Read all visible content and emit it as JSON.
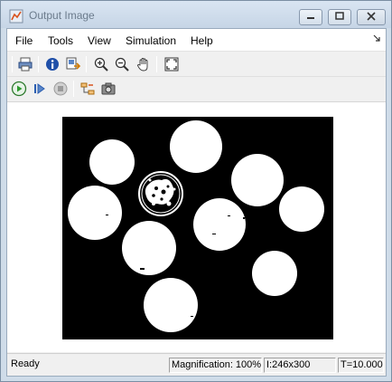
{
  "window": {
    "title": "Output Image",
    "controls": {
      "minimize_icon": "minimize-icon",
      "maximize_icon": "maximize-icon",
      "close_icon": "close-icon"
    }
  },
  "menubar": {
    "items": [
      "File",
      "Tools",
      "View",
      "Simulation",
      "Help"
    ]
  },
  "toolbar1": {
    "icons": [
      "print-icon",
      "info-icon",
      "export-image-icon",
      "zoom-in-icon",
      "zoom-out-icon",
      "pan-hand-icon",
      "fit-to-window-icon"
    ]
  },
  "toolbar2": {
    "icons": [
      "run-icon",
      "step-forward-icon",
      "stop-icon",
      "signal-hierarchy-icon",
      "snapshot-camera-icon"
    ]
  },
  "image": {
    "description_source": "binary segmented coins image",
    "background_color": "#000000",
    "foreground_color": "#ffffff"
  },
  "status": {
    "state": "Ready",
    "magnification": "Magnification: 100%",
    "image_size": "I:246x300",
    "time": "T=10.000"
  },
  "colors": {
    "title_text": "#6b7b8c",
    "frame": "#cfdce9",
    "run_green": "#2e9b2e",
    "stop_gray": "#9a9a9a",
    "accent_blue": "#2a5db0"
  }
}
